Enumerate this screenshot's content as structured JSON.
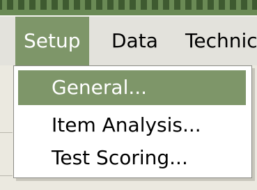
{
  "menubar": {
    "items": [
      {
        "label": "Setup"
      },
      {
        "label": "Data"
      },
      {
        "label": "Technic"
      }
    ]
  },
  "setup_menu": {
    "items": [
      {
        "label": "General..."
      },
      {
        "label": "Item Analysis..."
      },
      {
        "label": "Test Scoring..."
      }
    ]
  },
  "colors": {
    "highlight": "#7e9669",
    "titlebar": "#6a8a55",
    "menubar": "#e3e2dc"
  }
}
